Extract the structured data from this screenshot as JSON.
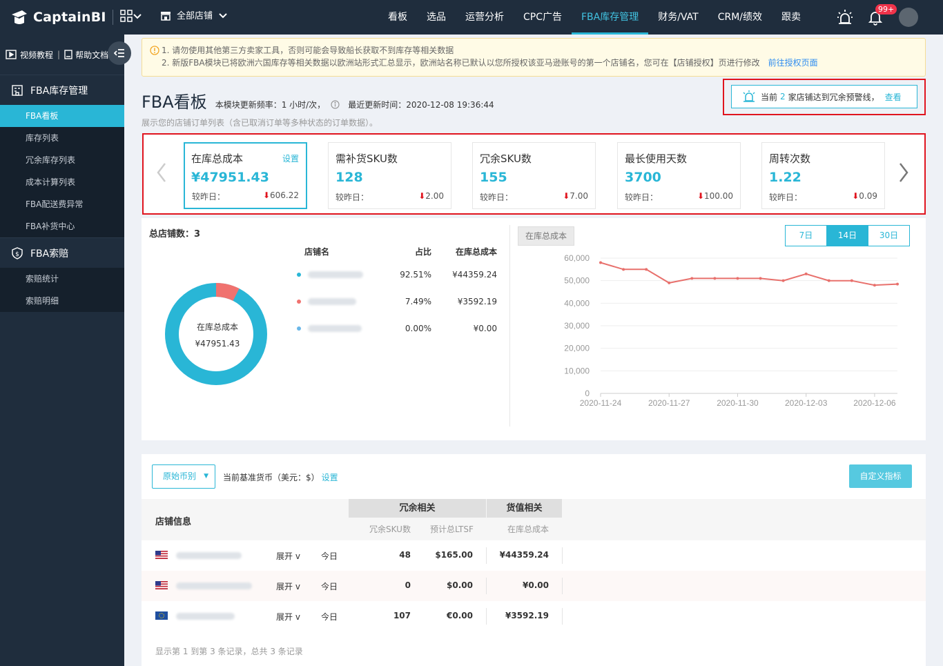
{
  "header": {
    "logo_text": "CaptainBI",
    "store_selector": "全部店铺",
    "nav": [
      "看板",
      "选品",
      "运营分析",
      "CPC广告",
      "FBA库存管理",
      "财务/VAT",
      "CRM/绩效",
      "跟卖"
    ],
    "active_nav": "FBA库存管理",
    "notification_badge": "99+"
  },
  "sidebar": {
    "video_tutorial": "视频教程",
    "help_doc": "帮助文档",
    "group1": {
      "label": "FBA库存管理",
      "items": [
        "FBA看板",
        "库存列表",
        "冗余库存列表",
        "成本计算列表",
        "FBA配送费异常",
        "FBA补货中心"
      ]
    },
    "group2": {
      "label": "FBA索赔",
      "items": [
        "索赔统计",
        "索赔明细"
      ]
    }
  },
  "notice": {
    "line1": "1. 请勿使用其他第三方卖家工具，否则可能会导致船长获取不到库存等相关数据",
    "line2": "2. 新版FBA模块已将欧洲六国库存等相关数据以欧洲站形式汇总显示，欧洲站名称已默认以您所授权该亚马逊账号的第一个店铺名，您可在【店铺授权】页进行修改",
    "link": "前往授权页面"
  },
  "page": {
    "title": "FBA看板",
    "update_freq": "本模块更新频率：1 小时/次，",
    "last_update": "最近更新时间：2020-12-08 19:36:44",
    "description": "展示您的店铺订单列表（含已取消订单等多种状态的订单数据）。"
  },
  "alert": {
    "prefix": "当前",
    "count": "2",
    "suffix": "家店铺达到冗余预警线，",
    "link": "查看"
  },
  "cards": [
    {
      "title": "在库总成本",
      "value": "¥47951.43",
      "foot_label": "较昨日：",
      "delta": "606.22",
      "setting": "设置"
    },
    {
      "title": "需补货SKU数",
      "value": "128",
      "foot_label": "较昨日：",
      "delta": "2.00"
    },
    {
      "title": "冗余SKU数",
      "value": "155",
      "foot_label": "较昨日：",
      "delta": "7.00"
    },
    {
      "title": "最长使用天数",
      "value": "3700",
      "foot_label": "较昨日：",
      "delta": "100.00"
    },
    {
      "title": "周转次数",
      "value": "1.22",
      "foot_label": "较昨日：",
      "delta": "0.09"
    }
  ],
  "overview": {
    "shop_count": "总店铺数：3",
    "donut_label": "在库总成本",
    "donut_value": "¥47951.43",
    "table_headers": [
      "店铺名",
      "占比",
      "在库总成本"
    ],
    "rows": [
      {
        "pct": "92.51%",
        "cost": "¥44359.24",
        "color": "#29b6d6"
      },
      {
        "pct": "7.49%",
        "cost": "¥3592.19",
        "color": "#f0726f"
      },
      {
        "pct": "0.00%",
        "cost": "¥0.00",
        "color": "#6ab7e8"
      }
    ]
  },
  "chart_controls": {
    "metric_tab": "在库总成本",
    "ranges": [
      "7日",
      "14日",
      "30日"
    ],
    "active_range": "14日"
  },
  "chart_data": {
    "type": "line",
    "x": [
      "2020-11-24",
      "2020-11-25",
      "2020-11-26",
      "2020-11-27",
      "2020-11-28",
      "2020-11-29",
      "2020-11-30",
      "2020-12-01",
      "2020-12-02",
      "2020-12-03",
      "2020-12-04",
      "2020-12-05",
      "2020-12-06",
      "2020-12-07"
    ],
    "x_ticks": [
      "2020-11-24",
      "2020-11-27",
      "2020-11-30",
      "2020-12-03",
      "2020-12-06"
    ],
    "series": [
      {
        "values": [
          58000,
          55000,
          55000,
          49000,
          51000,
          51000,
          51000,
          51000,
          50000,
          53000,
          50000,
          50000,
          48000,
          48500
        ]
      }
    ],
    "y_ticks": [
      "0",
      "10,000",
      "20,000",
      "30,000",
      "40,000",
      "50,000",
      "60,000"
    ],
    "ylim": [
      0,
      60000
    ],
    "color": "#e8706c"
  },
  "bottom": {
    "currency_select": "原始币别",
    "base_currency": "当前基准货币（美元：$）",
    "base_currency_link": "设置",
    "custom_btn": "自定义指标",
    "col_store": "店铺信息",
    "group_redundant": "冗余相关",
    "group_value": "货值相关",
    "col_sku": "冗余SKU数",
    "col_ltsf": "预计总LTSF",
    "col_cost": "在库总成本",
    "expand": "展开 v",
    "today": "今日",
    "rows": [
      {
        "flag": "us",
        "sku": "48",
        "ltsf": "$165.00",
        "cost": "¥44359.24"
      },
      {
        "flag": "us",
        "sku": "0",
        "ltsf": "$0.00",
        "cost": "¥0.00"
      },
      {
        "flag": "eu",
        "sku": "107",
        "ltsf": "€0.00",
        "cost": "¥3592.19"
      }
    ],
    "footer": "显示第 1 到第 3 条记录，总共 3 条记录"
  }
}
